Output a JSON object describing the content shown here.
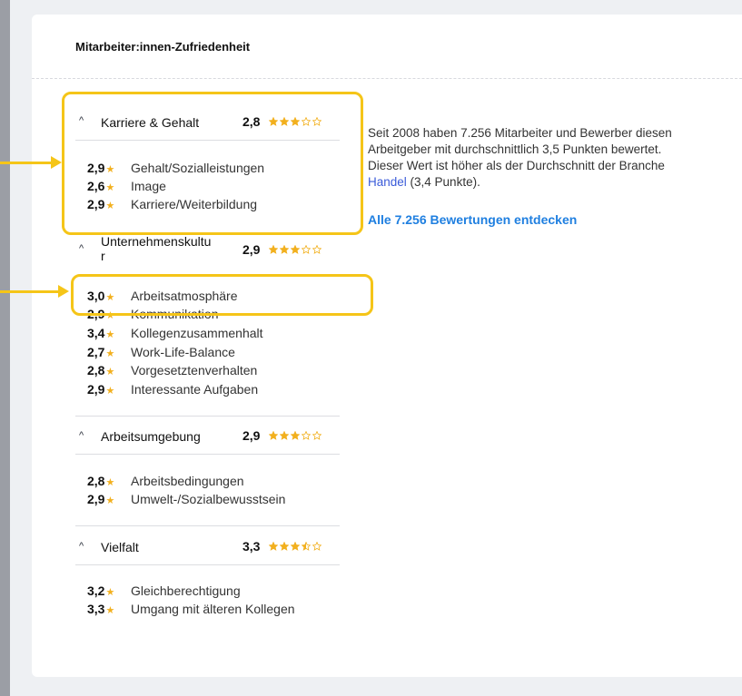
{
  "title": "Mitarbeiter:innen-Zufriedenheit",
  "colors": {
    "star": "#f2b01e",
    "star_empty": "#c9cdd4",
    "highlight": "#f5c518",
    "link": "#1f7fe0"
  },
  "sections": [
    {
      "title": "Karriere & Gehalt",
      "score": "2,8",
      "rating": 2.8,
      "items": [
        {
          "value": "2,9",
          "label": "Gehalt/Sozialleistungen"
        },
        {
          "value": "2,6",
          "label": "Image"
        },
        {
          "value": "2,9",
          "label": "Karriere/Weiterbildung"
        }
      ]
    },
    {
      "title": "Unternehmenskultu r",
      "score": "2,9",
      "rating": 2.9,
      "items": [
        {
          "value": "3,0",
          "label": "Arbeitsatmosphäre"
        },
        {
          "value": "2,9",
          "label": "Kommunikation"
        },
        {
          "value": "3,4",
          "label": "Kollegenzusammenhalt"
        },
        {
          "value": "2,7",
          "label": "Work-Life-Balance"
        },
        {
          "value": "2,8",
          "label": "Vorgesetztenverhalten"
        },
        {
          "value": "2,9",
          "label": "Interessante Aufgaben"
        }
      ]
    },
    {
      "title": "Arbeitsumgebung",
      "score": "2,9",
      "rating": 2.9,
      "items": [
        {
          "value": "2,8",
          "label": "Arbeitsbedingungen"
        },
        {
          "value": "2,9",
          "label": "Umwelt-/Sozialbewusstsein"
        }
      ]
    },
    {
      "title": "Vielfalt",
      "score": "3,3",
      "rating": 3.3,
      "items": [
        {
          "value": "3,2",
          "label": "Gleichberechtigung"
        },
        {
          "value": "3,3",
          "label": "Umgang mit älteren Kollegen"
        }
      ]
    }
  ],
  "description": {
    "text_before": "Seit 2008 haben 7.256 Mitarbeiter und Bewerber diesen Arbeitgeber mit durchschnittlich 3,5 Punkten bewertet. Dieser Wert ist höher als der Durchschnitt der Branche ",
    "link": "Handel",
    "text_after": " (3,4 Punkte)."
  },
  "cta": "Alle 7.256 Bewertungen entdecken"
}
